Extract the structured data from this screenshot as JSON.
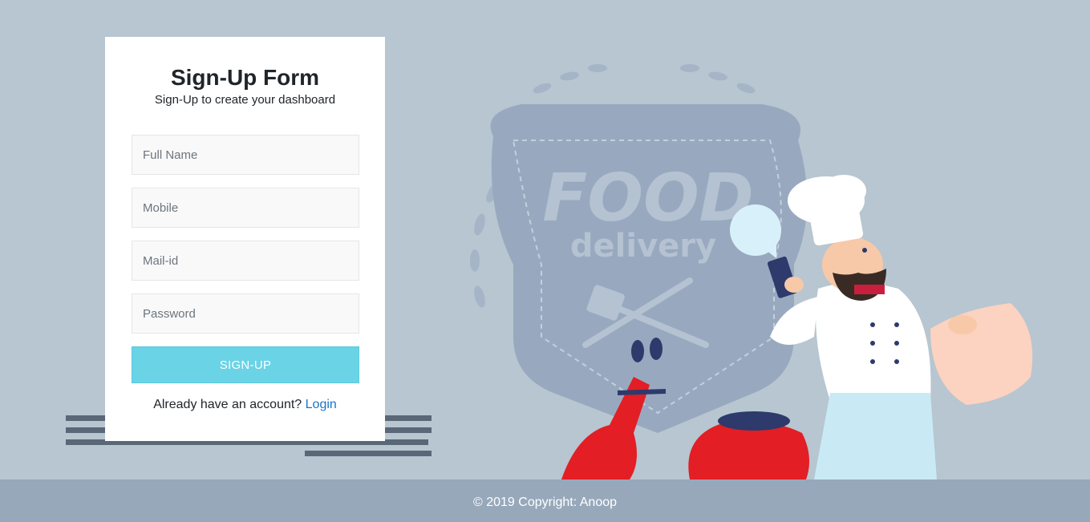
{
  "form": {
    "title": "Sign-Up Form",
    "subtitle": "Sign-Up to create your dashboard",
    "fields": {
      "full_name_placeholder": "Full Name",
      "mobile_placeholder": "Mobile",
      "mail_placeholder": "Mail-id",
      "password_placeholder": "Password"
    },
    "submit_label": "SIGN-UP",
    "account_prompt": "Already have an account?",
    "login_link": "Login"
  },
  "background": {
    "badge_word_1": "FOOD",
    "badge_word_2": "delivery"
  },
  "footer": {
    "copyright": "© 2019 Copyright: Anoop"
  },
  "colors": {
    "page_bg": "#b7c6d0",
    "card_bg": "#ffffff",
    "button_bg": "#6ad3e6",
    "footer_bg": "#97a8bb",
    "link": "#1a73c9"
  }
}
